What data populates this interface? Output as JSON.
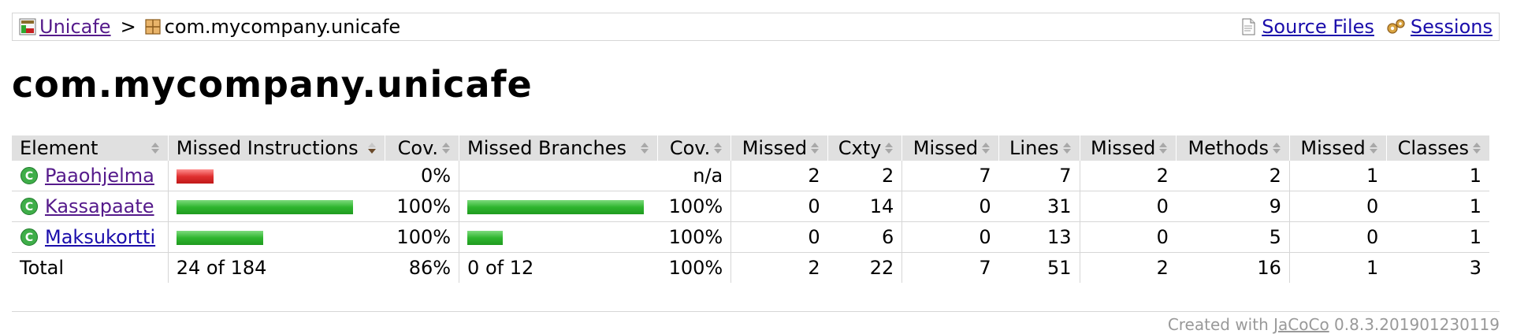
{
  "breadcrumb": {
    "report_link": "Unicafe",
    "separator": ">",
    "package": "com.mycompany.unicafe",
    "source_files": "Source Files",
    "sessions": "Sessions"
  },
  "page_title": "com.mycompany.unicafe",
  "table": {
    "headers": {
      "element": "Element",
      "missed_instructions": "Missed Instructions",
      "instr_cov": "Cov.",
      "missed_branches": "Missed Branches",
      "branch_cov": "Cov.",
      "cxty_missed": "Missed",
      "cxty": "Cxty",
      "lines_missed": "Missed",
      "lines": "Lines",
      "methods_missed": "Missed",
      "methods": "Methods",
      "classes_missed": "Missed",
      "classes": "Classes"
    },
    "rows": [
      {
        "name": "Paaohjelma",
        "instr_bar_fraction": 0.21,
        "instr_bar_color": "red",
        "instr_cov": "0%",
        "branch_bar_fraction": 0,
        "branch_bar_color": "",
        "branch_cov": "n/a",
        "cxty_missed": "2",
        "cxty": "2",
        "lines_missed": "7",
        "lines": "7",
        "methods_missed": "2",
        "methods": "2",
        "classes_missed": "1",
        "classes": "1"
      },
      {
        "name": "Kassapaate",
        "instr_bar_fraction": 1.0,
        "instr_bar_color": "green",
        "instr_cov": "100%",
        "branch_bar_fraction": 1.0,
        "branch_bar_color": "green",
        "branch_cov": "100%",
        "cxty_missed": "0",
        "cxty": "14",
        "lines_missed": "0",
        "lines": "31",
        "methods_missed": "0",
        "methods": "9",
        "classes_missed": "0",
        "classes": "1"
      },
      {
        "name": "Maksukortti",
        "instr_bar_fraction": 0.49,
        "instr_bar_color": "green",
        "instr_cov": "100%",
        "branch_bar_fraction": 0.2,
        "branch_bar_color": "green",
        "branch_cov": "100%",
        "cxty_missed": "0",
        "cxty": "6",
        "lines_missed": "0",
        "lines": "13",
        "methods_missed": "0",
        "methods": "5",
        "classes_missed": "0",
        "classes": "1"
      }
    ],
    "total": {
      "label": "Total",
      "missed_instructions": "24 of 184",
      "instr_cov": "86%",
      "missed_branches": "0 of 12",
      "branch_cov": "100%",
      "cxty_missed": "2",
      "cxty": "22",
      "lines_missed": "7",
      "lines": "51",
      "methods_missed": "2",
      "methods": "16",
      "classes_missed": "1",
      "classes": "3"
    }
  },
  "footer": {
    "prefix": "Created with",
    "tool": "JaCoCo",
    "version": "0.8.3.201901230119"
  },
  "colors": {
    "link": "#1a0dab",
    "visited_link": "#551a8b",
    "header_bg": "#e0e0e0",
    "bar_green": "#2fb52f",
    "bar_red": "#e03030"
  }
}
